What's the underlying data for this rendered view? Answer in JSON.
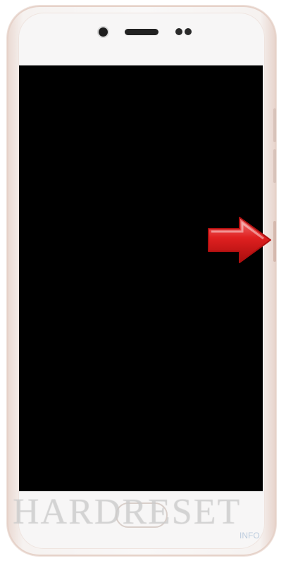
{
  "watermark": {
    "main": "HARDRESET",
    "sub": "INFO"
  },
  "arrow": {
    "color": "#d81a1a",
    "target": "power-button"
  },
  "colors": {
    "phone_body": "#f7f6f6",
    "frame_accent": "#e6d2c9",
    "screen": "#000000"
  }
}
